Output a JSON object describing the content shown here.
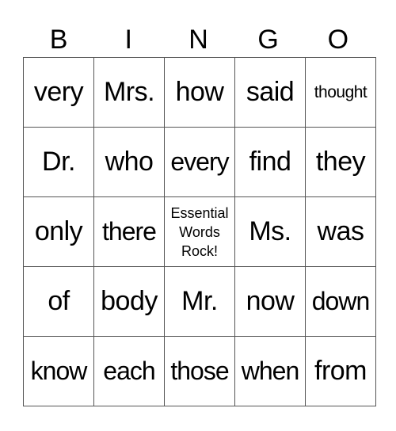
{
  "title_letters": [
    "B",
    "I",
    "N",
    "G",
    "O"
  ],
  "rows": [
    [
      "very",
      "Mrs.",
      "how",
      "said",
      "thought"
    ],
    [
      "Dr.",
      "who",
      "every",
      "find",
      "they"
    ],
    [
      "only",
      "there",
      "Essential Words Rock!",
      "Ms.",
      "was"
    ],
    [
      "of",
      "body",
      "Mr.",
      "now",
      "down"
    ],
    [
      "know",
      "each",
      "those",
      "when",
      "from"
    ]
  ],
  "free_space": {
    "line1": "Essential",
    "line2": "Words",
    "line3": "Rock!"
  }
}
